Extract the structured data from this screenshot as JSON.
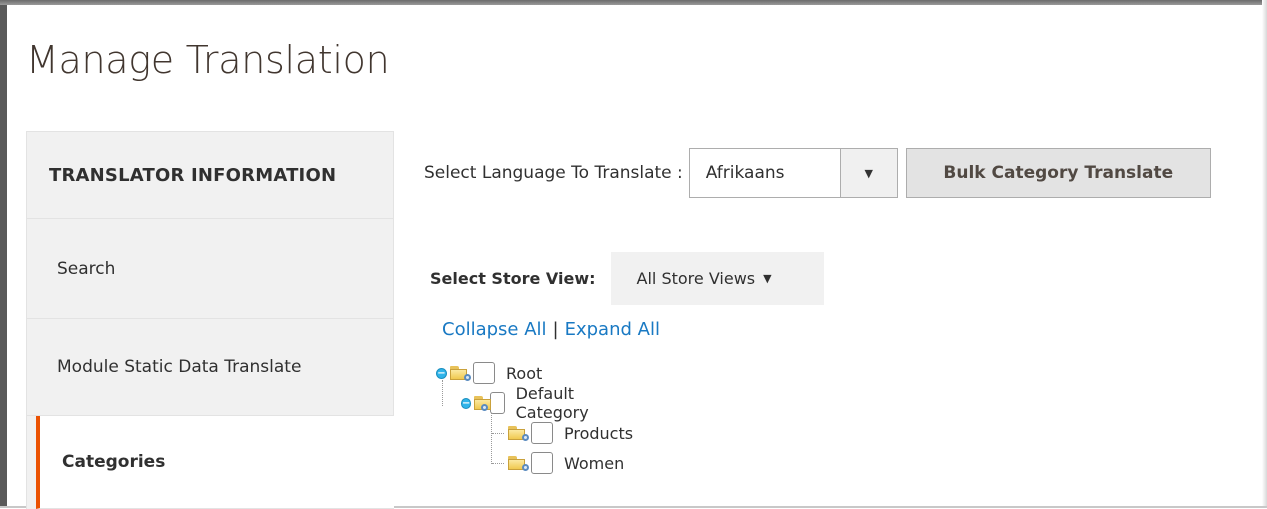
{
  "page": {
    "title": "Manage Translation"
  },
  "sidebar": {
    "heading": "TRANSLATOR INFORMATION",
    "items": [
      {
        "label": "Search"
      },
      {
        "label": "Module Static Data Translate"
      },
      {
        "label": "Categories",
        "active": true
      }
    ]
  },
  "language": {
    "label": "Select Language To Translate :",
    "selected": "Afrikaans",
    "bulk_button": "Bulk Category Translate"
  },
  "store_view": {
    "label": "Select Store View:",
    "selected": "All Store Views"
  },
  "tree_controls": {
    "collapse_all": "Collapse All",
    "separator": "|",
    "expand_all": "Expand All"
  },
  "tree": [
    {
      "label": "Root",
      "expanded": true
    },
    {
      "label": "Default Category",
      "expanded": true
    },
    {
      "label": "Products"
    },
    {
      "label": "Women"
    }
  ],
  "colors": {
    "accent": "#eb5202",
    "link": "#1979c3",
    "sidebar_bg": "#f1f1f1"
  }
}
